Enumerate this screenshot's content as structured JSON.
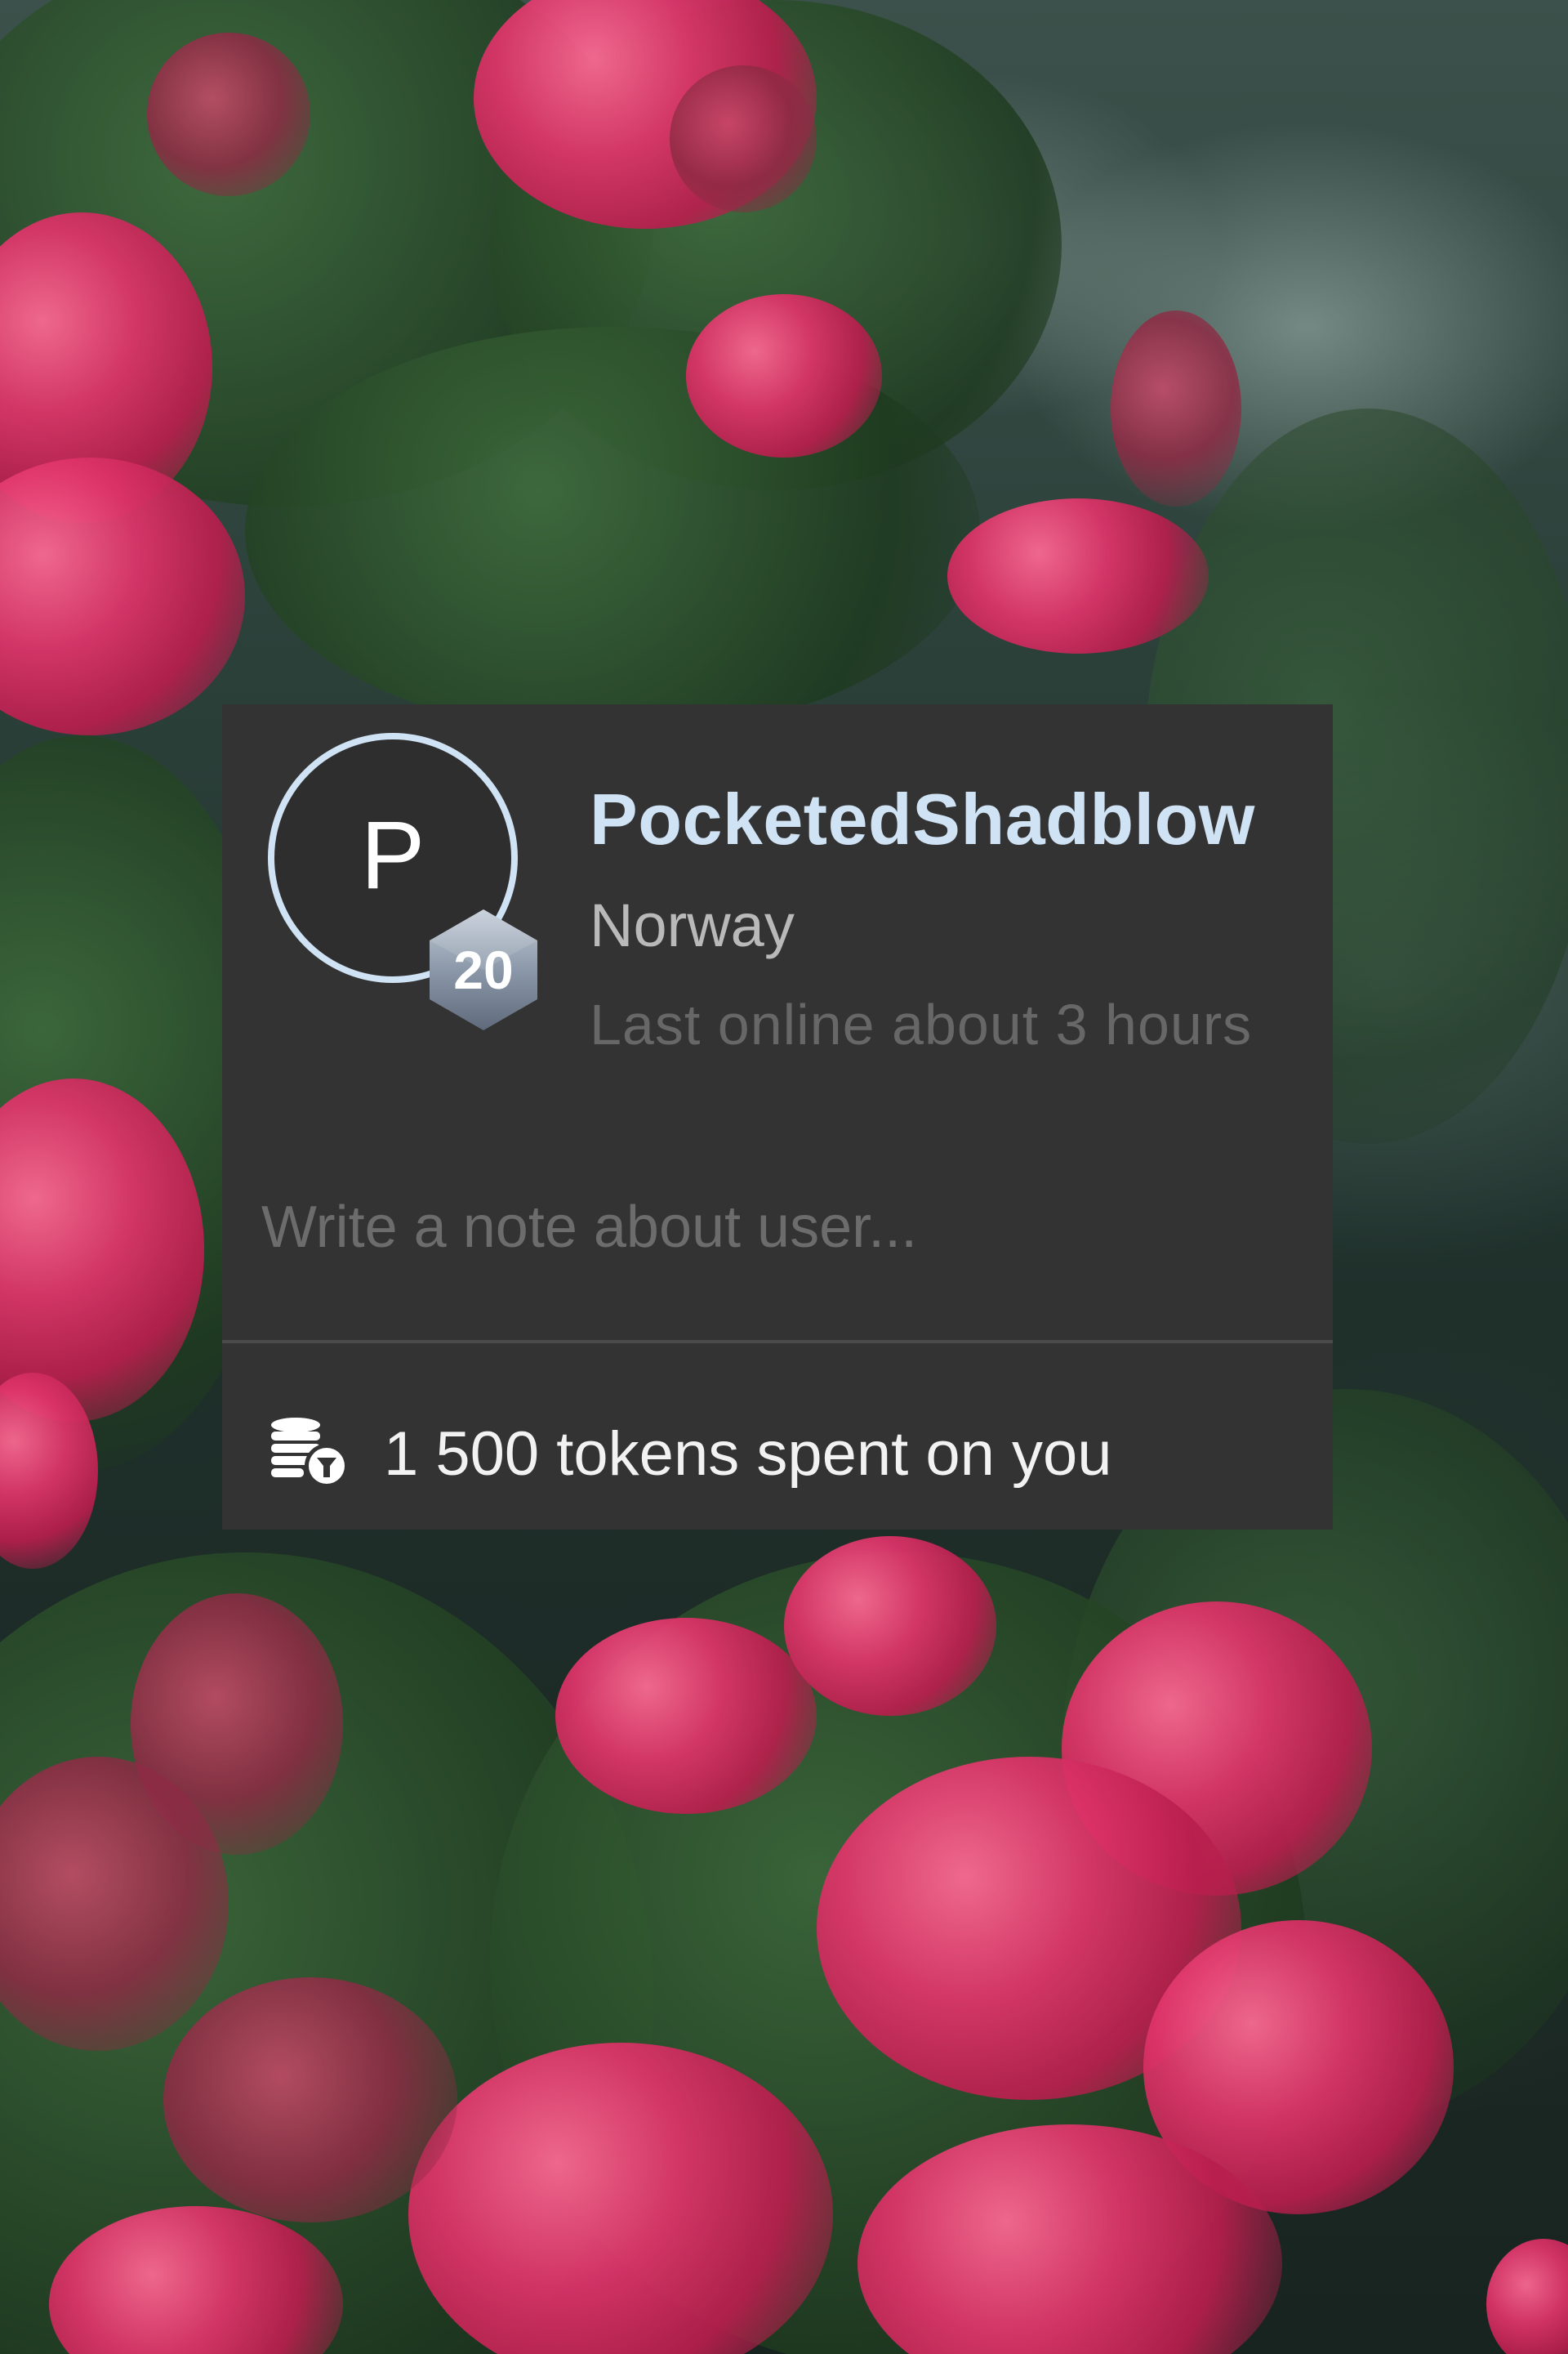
{
  "profile": {
    "avatar_initial": "P",
    "level": "20",
    "username": "PocketedShadblow",
    "country": "Norway",
    "last_online": "Last online about 3 hours"
  },
  "note": {
    "placeholder": "Write a note about user...",
    "value": ""
  },
  "tokens": {
    "icon": "coins-icon",
    "text": "1 500 tokens spent on you"
  },
  "colors": {
    "card_background": "#333333",
    "username": "#cfe3f5",
    "avatar_ring": "#cfe3f5",
    "badge": "#8a97a8"
  }
}
